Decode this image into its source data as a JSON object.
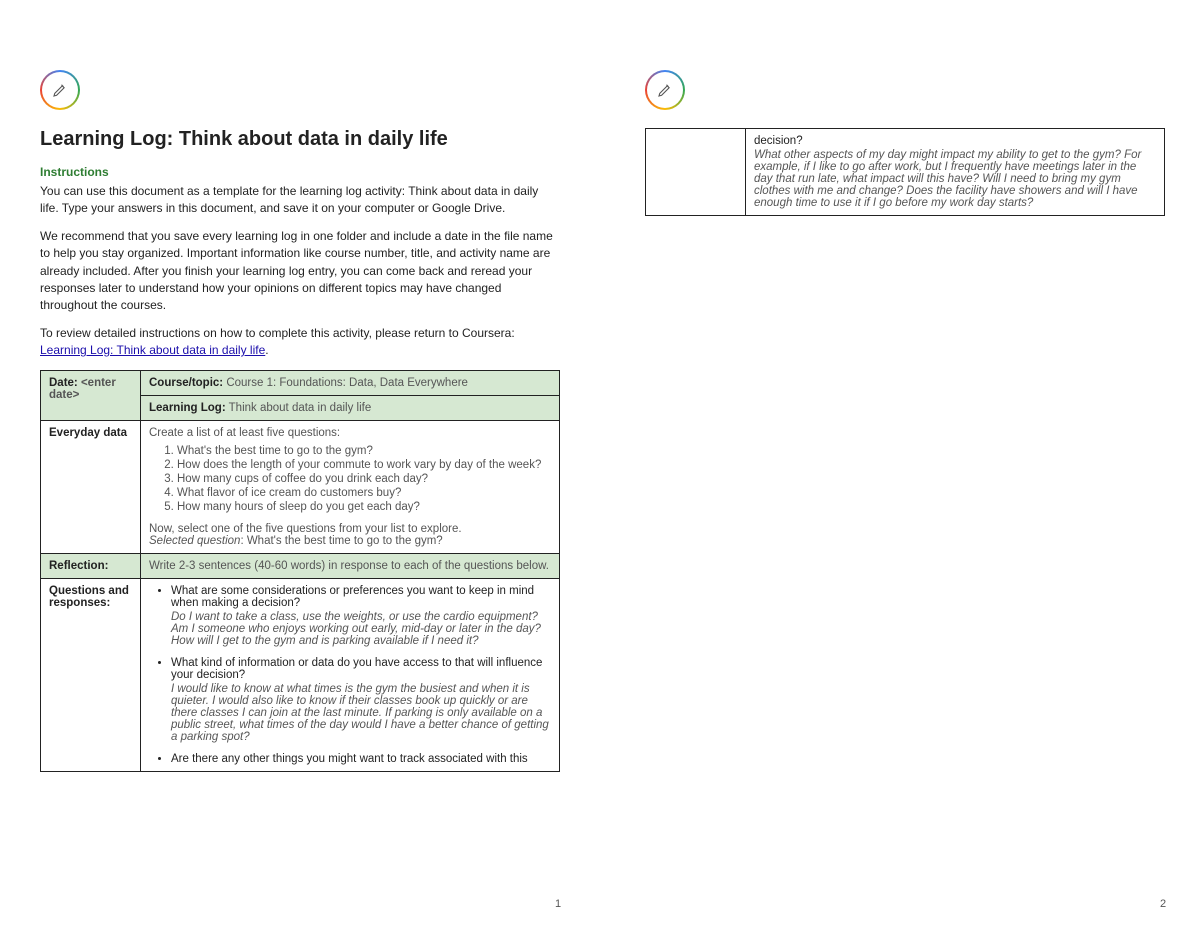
{
  "title": "Learning Log: Think about data in daily life",
  "instructions_heading": "Instructions",
  "intro": {
    "p1": "You can use this document as a template for the learning log activity: Think about data in daily life. Type your answers in this document, and save it on your computer or Google Drive.",
    "p2": "We recommend that you save every learning log in one folder and include a date in the file name to help you stay organized. Important information like course number, title, and activity name are already included. After you finish your learning log entry, you can come back and reread your responses later to understand how your opinions on different topics may have changed throughout the courses.",
    "p3_prefix": "To review detailed instructions on how to complete this activity, please return to Coursera: ",
    "p3_link": "Learning Log: Think about data in daily life",
    "p3_suffix": "."
  },
  "table": {
    "date_label": "Date:",
    "date_value": " <enter date>",
    "course_label": "Course/topic:",
    "course_value": " Course 1: Foundations: Data, Data Everywhere",
    "log_label": "Learning Log:",
    "log_value": " Think about data in daily life",
    "everyday_label": "Everyday data",
    "everyday_intro": "Create a list of at least five questions:",
    "questions": [
      "What's the best time to go to the gym?",
      "How does the length of your commute to work vary by day of the week?",
      "How many cups of coffee do you drink each day?",
      "What flavor of ice cream do customers buy?",
      "How many hours of sleep do you get each day?"
    ],
    "everyday_select": "Now, select one of the five questions from your list to explore.",
    "everyday_selected_label": "Selected question",
    "everyday_selected": ": What's the best time to go to the gym?",
    "reflection_label": "Reflection:",
    "reflection_text": "Write 2-3 sentences (40-60 words) in response to each of the questions below.",
    "qr_label": "Questions and responses:",
    "bullets": [
      {
        "q": "What are some considerations or preferences you want to keep in mind when making a decision?",
        "a": "Do I want to take a class, use the weights, or use the cardio equipment? Am I someone who enjoys working out early, mid-day or later in the day? How will I get to the gym and is parking available if I need it?"
      },
      {
        "q": "What kind of information or data do you have access to that will influence your decision?",
        "a": "I would like to know at what times is the gym the busiest and when it is quieter. I would also like to know if their classes book up quickly or are there classes I can join at the last minute. If parking is only available on a public street, what times of the day would I have a better chance of getting a parking spot?"
      },
      {
        "q": "Are there any other things you might want to track associated with this",
        "a": ""
      }
    ]
  },
  "page2": {
    "cont_q": "decision?",
    "cont_a": "What other aspects of my day might impact my ability to get to the gym? For example, if I like to go after work, but I frequently have meetings later in the day that run late, what impact will this have? Will I need to bring my gym clothes with me and change? Does the facility have showers and will I have enough time to use it if I go before my work day starts?"
  },
  "page_numbers": {
    "one": "1",
    "two": "2"
  }
}
